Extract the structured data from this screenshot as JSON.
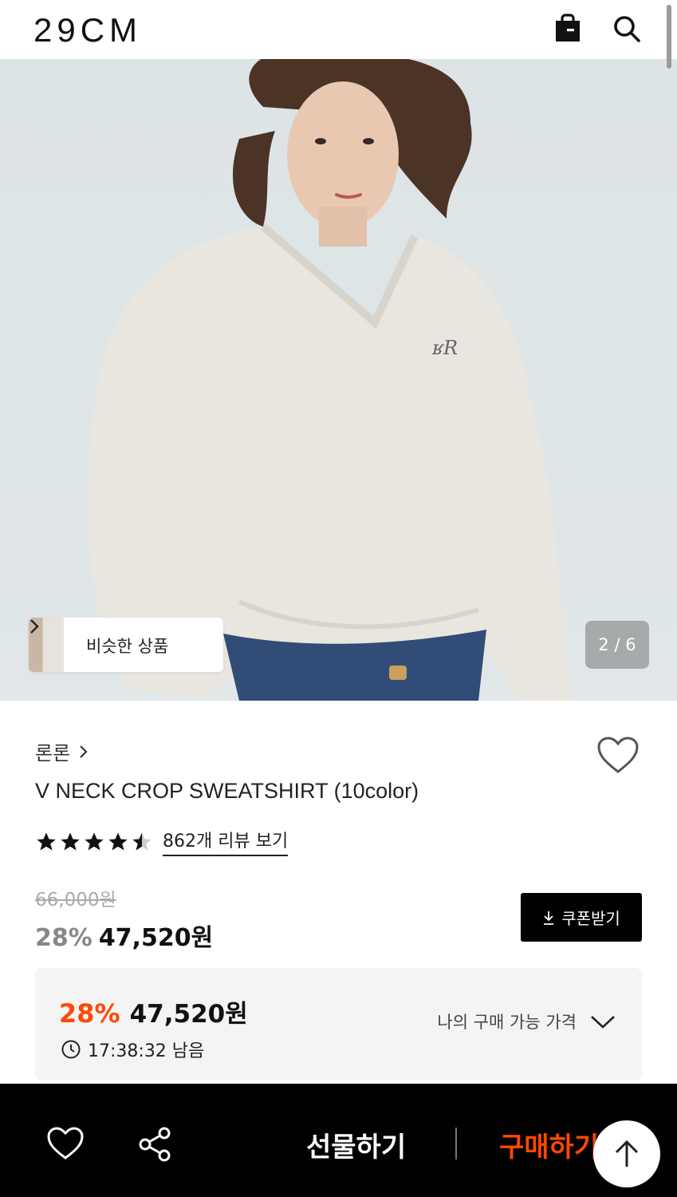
{
  "header": {
    "logo": "29CM",
    "icons": [
      "shopping-bag-icon",
      "search-icon"
    ]
  },
  "gallery": {
    "similar_label": "비슷한 상품",
    "page_indicator": "2 / 6"
  },
  "product": {
    "brand": "론론",
    "title": "V NECK CROP SWEATSHIRT (10color)",
    "rating_stars": 4.5,
    "review_link": "862개 리뷰 보기",
    "original_price": "66,000원",
    "discount": "28%",
    "sale_price": "47,520원",
    "coupon_label": "쿠폰받기"
  },
  "my_price": {
    "discount": "28%",
    "price": "47,520원",
    "timer": "17:38:32 남음",
    "toggle_label": "나의 구매 가능 가격"
  },
  "bottom_bar": {
    "gift_label": "선물하기",
    "buy_label": "구매하기"
  },
  "colors": {
    "accent": "#ff4800",
    "bottom_bar_bg": "#000000",
    "coupon_bg": "#000000"
  }
}
